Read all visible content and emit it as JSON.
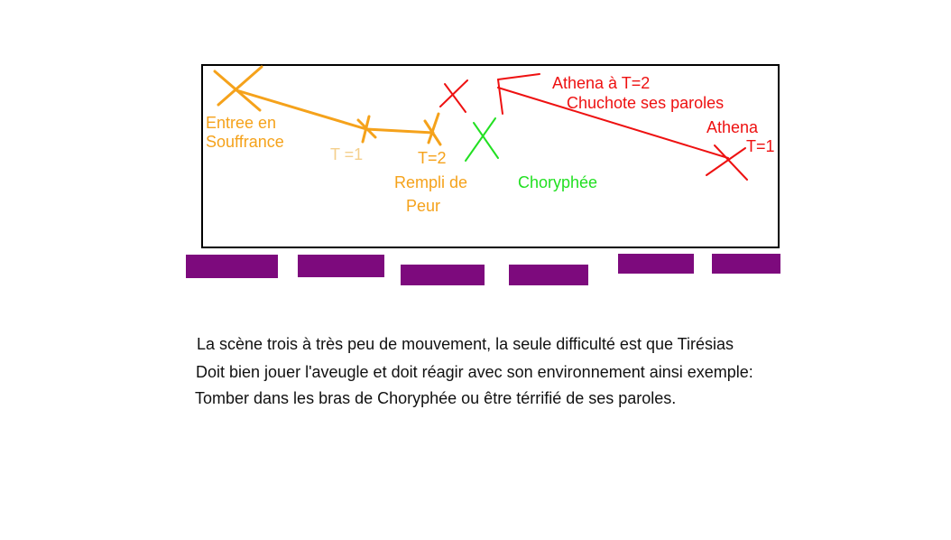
{
  "colors": {
    "orange": "#f5a21b",
    "light_orange": "#f4cf8c",
    "green": "#22e022",
    "red": "#ee1111",
    "purple": "#7d0a7d",
    "frame": "#000000"
  },
  "diagram": {
    "labels": {
      "entree_line1": "Entree en",
      "entree_line2": "Souffrance",
      "t1_orange": "T =1",
      "t2_orange": "T=2",
      "rempli_line1": "Rempli de",
      "rempli_line2": "Peur",
      "choryphee": "Choryphée",
      "athena_t2": "Athena à T=2",
      "chuchote": "Chuchote ses paroles",
      "athena": "Athena",
      "athena_t1": "T=1"
    }
  },
  "notes": {
    "line1": "La scène trois à très peu de mouvement, la seule difficulté est que Tirésias",
    "line2": "Doit bien jouer l'aveugle et doit réagir avec son environnement ainsi exemple:",
    "line3": "Tomber dans les bras de Choryphée ou être térrifié de ses paroles."
  }
}
